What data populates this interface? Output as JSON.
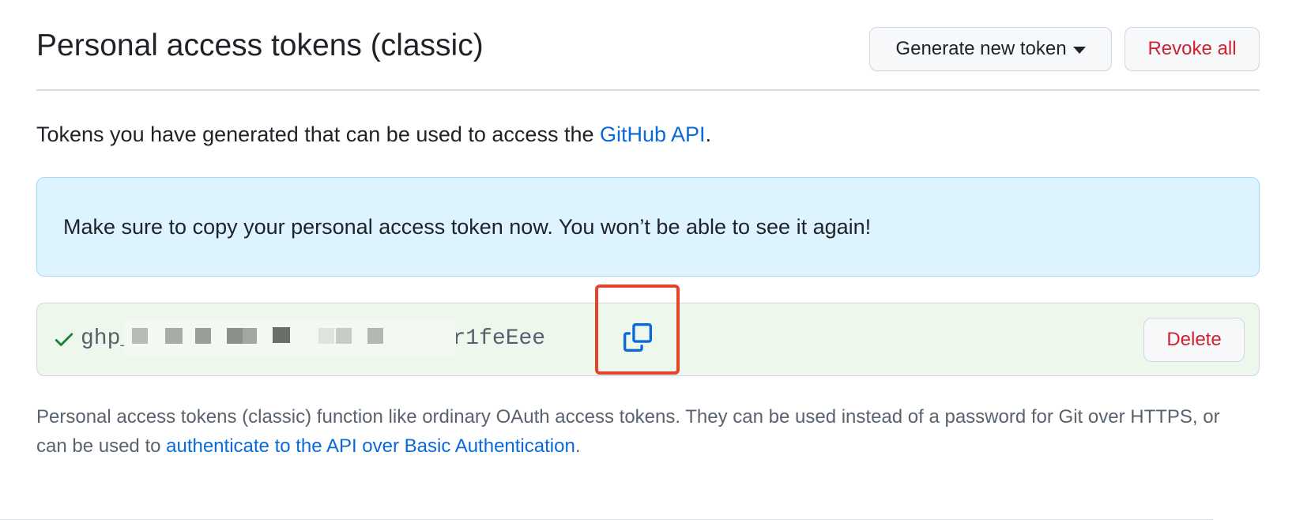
{
  "header": {
    "title": "Personal access tokens (classic)",
    "generate_label": "Generate new token",
    "revoke_label": "Revoke all"
  },
  "description": {
    "text": "Tokens you have generated that can be used to access the ",
    "link": "GitHub API",
    "suffix": "."
  },
  "flash": {
    "message": "Make sure to copy your personal access token now. You won’t be able to see it again!"
  },
  "token": {
    "prefix": "ghp_",
    "visible_suffix": "v0x378lrir1feEee",
    "delete_label": "Delete"
  },
  "note": {
    "text": "Personal access tokens (classic) function like ordinary OAuth access tokens. They can be used instead of a password for Git over HTTPS, or can be used to ",
    "link": "authenticate to the API over Basic Authentication",
    "suffix": "."
  },
  "colors": {
    "link": "#0969da",
    "danger": "#cf222e",
    "success": "#1a7f37",
    "flash_bg": "#ddf4ff",
    "token_bg": "#eef7ec",
    "highlight": "#e5432a"
  },
  "icons": {
    "check": "check-icon",
    "copy": "copy-icon",
    "caret": "triangle-down-icon"
  }
}
